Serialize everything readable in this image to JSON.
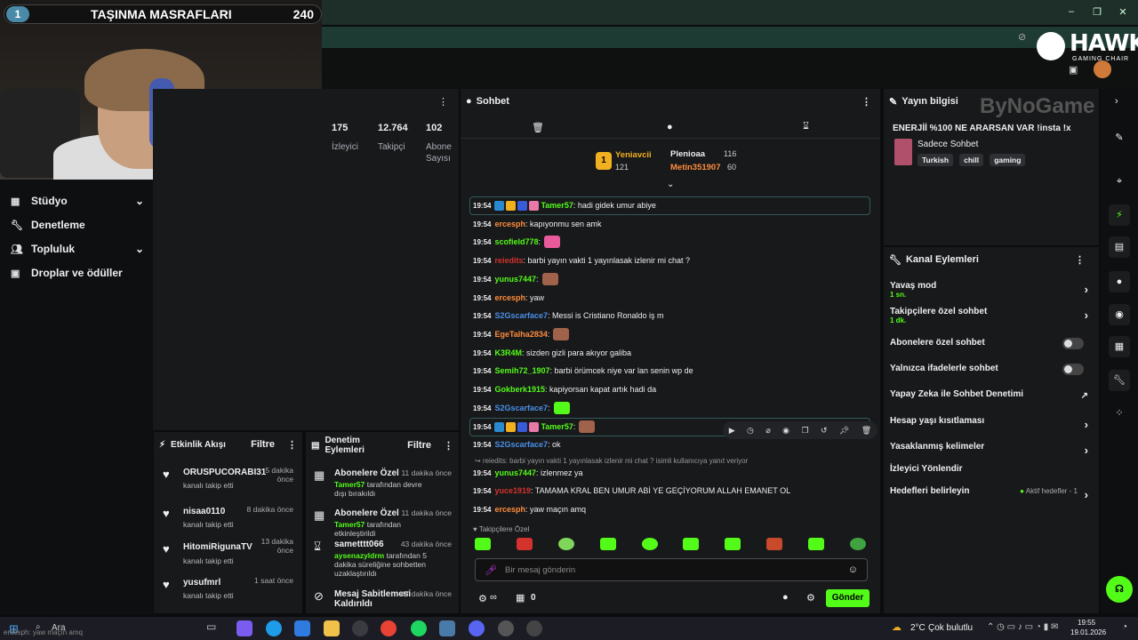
{
  "overlay": {
    "goal_number": "1",
    "goal_title": "TAŞINMA MASRAFLARI",
    "goal_count": "240"
  },
  "brand": {
    "hawk_title": "HAWK",
    "hawk_sub": "GAMING CHAIR",
    "bynogame": "ByNoGame"
  },
  "nav": {
    "items": [
      {
        "label": "Stüdyo",
        "icon": "studio-icon",
        "has_chevron": true
      },
      {
        "label": "Denetleme",
        "icon": "wrench-icon",
        "has_chevron": false
      },
      {
        "label": "Topluluk",
        "icon": "users-icon",
        "has_chevron": true
      },
      {
        "label": "Droplar ve ödüller",
        "icon": "gift-icon",
        "has_chevron": false
      }
    ]
  },
  "stats": {
    "viewers_value": "175",
    "viewers_label": "İzleyici",
    "followers_value": "12.764",
    "followers_label": "Takipçi",
    "subs_value": "102",
    "subs_label1": "Abone",
    "subs_label2": "Sayısı"
  },
  "activity": {
    "title": "Etkinlik Akışı",
    "filter": "Filtre",
    "rows": [
      {
        "name": "ORUSPUCORABI31",
        "action": "kanalı takip etti",
        "time1": "5 dakika",
        "time2": "önce"
      },
      {
        "name": "nisaa0110",
        "action": "kanalı takip etti",
        "time1": "8 dakika önce",
        "time2": ""
      },
      {
        "name": "HitomiRigunaTV",
        "action": "kanalı takip etti",
        "time1": "13 dakika",
        "time2": "önce"
      },
      {
        "name": "yusufmrl",
        "action": "kanalı takip etti",
        "time1": "1 saat önce",
        "time2": ""
      }
    ]
  },
  "modactions": {
    "title1": "Denetim",
    "title2": "Eylemleri",
    "filter": "Filtre",
    "rows": [
      {
        "name": "Abonelere Özel",
        "user": "Tamer57",
        "text": " tarafından devre dışı bırakıldı",
        "time": "11 dakika önce"
      },
      {
        "name": "Abonelere Özel",
        "user": "Tamer57",
        "text": " tarafından etkinleştirildi",
        "time": "11 dakika önce"
      },
      {
        "name": "sametttt066",
        "user": "aysenazyldrm",
        "text": " tarafından 5 dakika süreliğine sohbetten uzaklaştırıldı",
        "time": "43 dakika önce"
      },
      {
        "name": "Mesaj Sabitlemesi Kaldırıldı",
        "user": "",
        "text": "",
        "time": "47 dakika önce"
      }
    ]
  },
  "chat": {
    "title": "Sohbet",
    "top": {
      "first_name": "Yeniavcii",
      "first_val": "121",
      "second_name": "Plenioaa",
      "second_val": "116",
      "third_name": "Metin351907",
      "third_val": "60",
      "first_rank": "1"
    },
    "messages": [
      {
        "time": "19:54",
        "user": "Tamer57",
        "color": "#53fc18",
        "text": ": hadi gidek umur abiye",
        "emote": "",
        "badges": true,
        "highlight": true
      },
      {
        "time": "19:54",
        "user": "ercesph",
        "color": "#ff8c3c",
        "text": ": kapıyonmu sen amk",
        "emote": ""
      },
      {
        "time": "19:54",
        "user": "scofield778",
        "color": "#53fc18",
        "text": ":",
        "emote": "#e85a9a"
      },
      {
        "time": "19:54",
        "user": "reiedits",
        "color": "#d4322c",
        "text": ": barbi yayın vakti 1 yayınlasak izlenir mi chat ?",
        "emote": ""
      },
      {
        "time": "19:54",
        "user": "yunus7447",
        "color": "#53fc18",
        "text": ":",
        "emote": "#a0624a"
      },
      {
        "time": "19:54",
        "user": "ercesph",
        "color": "#ff8c3c",
        "text": ": yaw",
        "emote": ""
      },
      {
        "time": "19:54",
        "user": "S2Gscarface7",
        "color": "#4a8fe8",
        "text": ": Messi is Cristiano Ronaldo iş m",
        "emote": ""
      },
      {
        "time": "19:54",
        "user": "EgeTalha2834",
        "color": "#ff8c3c",
        "text": ":",
        "emote": "#a0624a"
      },
      {
        "time": "19:54",
        "user": "K3R4M",
        "color": "#53fc18",
        "text": ": sizden gizli para akıyor galiba",
        "emote": ""
      },
      {
        "time": "19:54",
        "user": "Semih72_1907",
        "color": "#53fc18",
        "text": ": barbi örümcek niye var lan senin wp de",
        "emote": ""
      },
      {
        "time": "19:54",
        "user": "Gokberk1915",
        "color": "#53fc18",
        "text": ": kapiyorsan kapat artık hadi da",
        "emote": ""
      },
      {
        "time": "19:54",
        "user": "S2Gscarface7",
        "color": "#4a8fe8",
        "text": ":",
        "emote": "#53fc18"
      },
      {
        "time": "19:54",
        "user": "Tamer57",
        "color": "#53fc18",
        "text": ":",
        "emote": "#a0624a",
        "badges": true,
        "highlight": true
      },
      {
        "time": "19:54",
        "user": "S2Gscarface7",
        "color": "#4a8fe8",
        "text": ": ok",
        "emote": ""
      }
    ],
    "reply_context": "reiedits: barbi yayın vakti 1 yayınlasak izlenir mi chat ? isimli kullanıcıya yanıt veriyor",
    "after": [
      {
        "time": "19:54",
        "user": "yunus7447",
        "color": "#53fc18",
        "text": ": izlenmez ya"
      },
      {
        "time": "19:54",
        "user": "yuce1919",
        "color": "#d4322c",
        "text": ": TAMAMA KRAL BEN UMUR ABİ YE GEÇİYORUM ALLAH EMANET OL"
      },
      {
        "time": "19:54",
        "user": "ercesph",
        "color": "#ff8c3c",
        "text": ": yaw maçın amq"
      }
    ],
    "follower_only": "Takipçilere Özel",
    "input_placeholder": "Bir mesaj gönderin",
    "points": "∞",
    "count": "0",
    "send": "Gönder"
  },
  "info": {
    "title": "Yayın bilgisi",
    "stream_title": "ENERJİİ %100 NE ARARSAN VAR !insta !x",
    "category": "Sadece Sohbet",
    "tags": [
      "Turkish",
      "chill",
      "gaming"
    ]
  },
  "actions": {
    "title": "Kanal Eylemleri",
    "slow": "Yavaş mod",
    "slow_val": "1 sn.",
    "followers": "Takipçilere özel sohbet",
    "followers_val": "1 dk.",
    "subs": "Abonelere özel sohbet",
    "emotes": "Yalnızca ifadelerle sohbet",
    "ai": "Yapay Zeka ile Sohbet Denetimi",
    "age": "Hesap yaşı kısıtlaması",
    "banned": "Yasaklanmış kelimeler",
    "redirect": "İzleyici Yönlendir",
    "goals": "Hedefleri belirleyin",
    "goals_status": "Aktif hedefler - 1"
  },
  "taskbar": {
    "search": "Ara",
    "overlay_text": "ercesph: yaw maçın amq",
    "weather": "2°C",
    "weather_text": "Çok bulutlu",
    "time": "19:55",
    "date": "19.01.2026"
  },
  "colors": {
    "accent": "#53fc18",
    "panel": "#18191b",
    "background": "#0b0c0d"
  }
}
